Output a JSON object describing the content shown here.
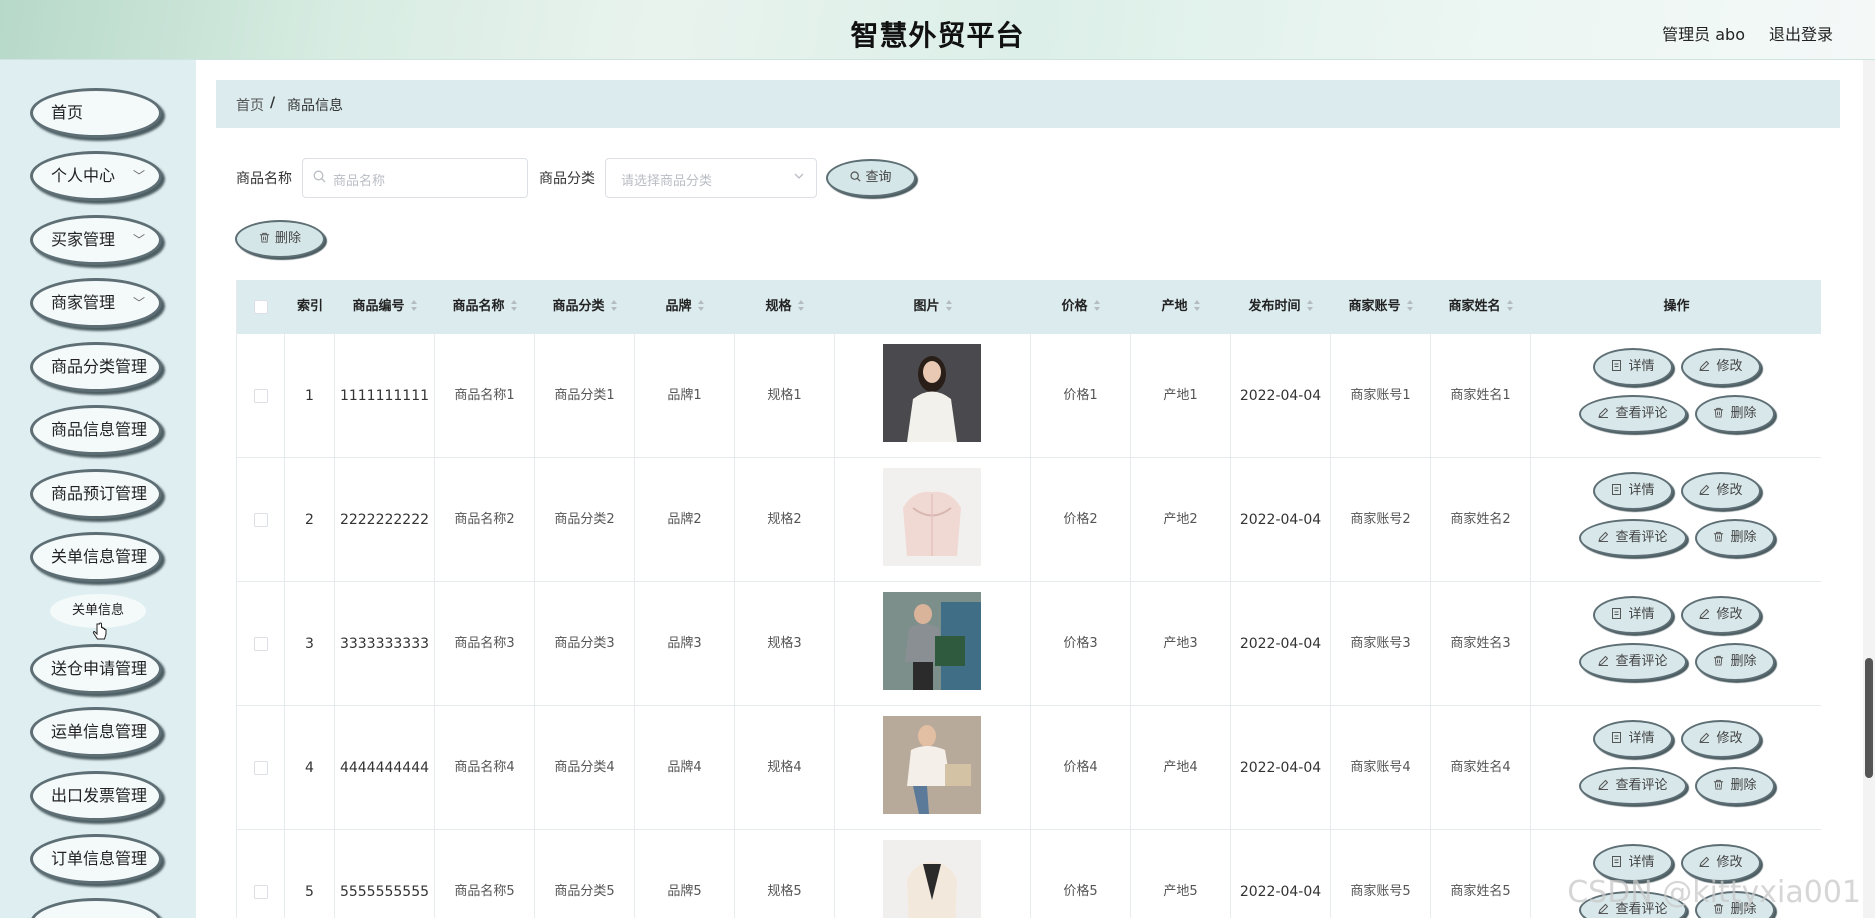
{
  "header": {
    "title": "智慧外贸平台",
    "user": "管理员 abo",
    "logout": "退出登录"
  },
  "sidebar": {
    "items": [
      {
        "label": "首页"
      },
      {
        "label": "个人中心"
      },
      {
        "label": "买家管理"
      },
      {
        "label": "商家管理"
      },
      {
        "label": "商品分类管理"
      },
      {
        "label": "商品信息管理"
      },
      {
        "label": "商品预订管理"
      },
      {
        "label": "关单信息管理"
      },
      {
        "label": "送仓申请管理"
      },
      {
        "label": "运单信息管理"
      },
      {
        "label": "出口发票管理"
      },
      {
        "label": "订单信息管理"
      }
    ],
    "subitem": "关单信息"
  },
  "breadcrumb": {
    "home": "首页",
    "separator": "/",
    "current": "商品信息"
  },
  "search": {
    "name_label": "商品名称",
    "name_placeholder": "商品名称",
    "category_label": "商品分类",
    "category_placeholder": "请选择商品分类",
    "query_button": "查询"
  },
  "toolbar": {
    "delete_button": "删除"
  },
  "table": {
    "headers": {
      "index": "索引",
      "code": "商品编号",
      "name": "商品名称",
      "category": "商品分类",
      "brand": "品牌",
      "spec": "规格",
      "image": "图片",
      "price": "价格",
      "origin": "产地",
      "publish_time": "发布时间",
      "merchant_account": "商家账号",
      "merchant_name": "商家姓名",
      "actions": "操作"
    },
    "actions": {
      "detail": "详情",
      "edit": "修改",
      "review": "查看评论",
      "delete": "删除"
    },
    "rows": [
      {
        "index": "1",
        "code": "1111111111",
        "name": "商品名称1",
        "category": "商品分类1",
        "brand": "品牌1",
        "spec": "规格1",
        "price": "价格1",
        "origin": "产地1",
        "publish_time": "2022-04-04",
        "merchant_account": "商家账号1",
        "merchant_name": "商家姓名1"
      },
      {
        "index": "2",
        "code": "2222222222",
        "name": "商品名称2",
        "category": "商品分类2",
        "brand": "品牌2",
        "spec": "规格2",
        "price": "价格2",
        "origin": "产地2",
        "publish_time": "2022-04-04",
        "merchant_account": "商家账号2",
        "merchant_name": "商家姓名2"
      },
      {
        "index": "3",
        "code": "3333333333",
        "name": "商品名称3",
        "category": "商品分类3",
        "brand": "品牌3",
        "spec": "规格3",
        "price": "价格3",
        "origin": "产地3",
        "publish_time": "2022-04-04",
        "merchant_account": "商家账号3",
        "merchant_name": "商家姓名3"
      },
      {
        "index": "4",
        "code": "4444444444",
        "name": "商品名称4",
        "category": "商品分类4",
        "brand": "品牌4",
        "spec": "规格4",
        "price": "价格4",
        "origin": "产地4",
        "publish_time": "2022-04-04",
        "merchant_account": "商家账号4",
        "merchant_name": "商家姓名4"
      },
      {
        "index": "5",
        "code": "5555555555",
        "name": "商品名称5",
        "category": "商品分类5",
        "brand": "品牌5",
        "spec": "规格5",
        "price": "价格5",
        "origin": "产地5",
        "publish_time": "2022-04-04",
        "merchant_account": "商家账号5",
        "merchant_name": "商家姓名5"
      }
    ]
  },
  "watermark": "CSDN @kittyxia001"
}
